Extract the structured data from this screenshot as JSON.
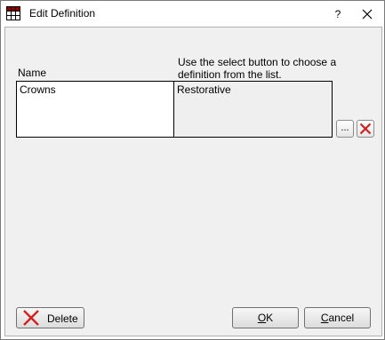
{
  "window": {
    "title": "Edit Definition",
    "help_label": "?"
  },
  "form": {
    "name_label": "Name",
    "definition_hint": "Use the select button to choose a definition from the list.",
    "name_value": "Crowns",
    "definition_value": "Restorative",
    "select_button_label": "..."
  },
  "buttons": {
    "delete_label": "Delete",
    "ok_label_mnemonic": "O",
    "ok_label_rest": "K",
    "cancel_label_mnemonic": "C",
    "cancel_label_rest": "ancel"
  },
  "icons": {
    "app": "grid-app-icon",
    "close": "close-icon",
    "clear": "red-x-icon",
    "delete": "red-x-icon"
  },
  "colors": {
    "delete_x": "#d42020",
    "definition_bg": "#f0eff0"
  }
}
